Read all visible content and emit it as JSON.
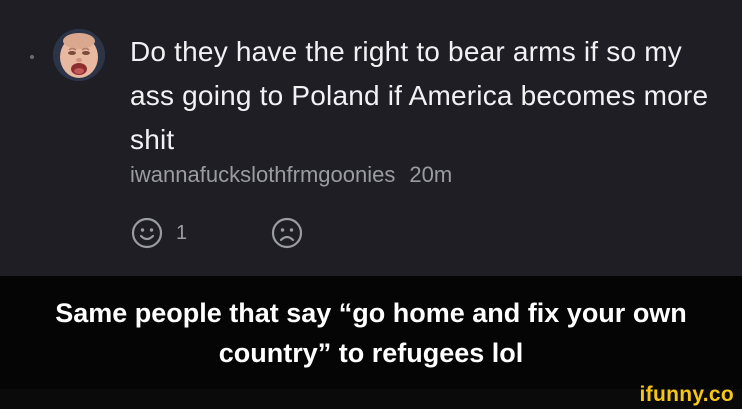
{
  "comment": {
    "text": "Do they have the right to bear arms if so my ass going to Poland if America becomes more shit",
    "username": "iwannafuckslothfrmgoonies",
    "time": "20m",
    "likes": "1",
    "icons": {
      "avatar": "baby-face-avatar",
      "like": "smiley-face-icon",
      "dislike": "frown-face-icon"
    }
  },
  "caption": {
    "text": "Same people that say “go home and fix your own country” to refugees lol"
  },
  "watermark": {
    "text": "ifunny.co"
  },
  "colors": {
    "card_background": "#1e1e24",
    "caption_background": "#050505",
    "comment_text": "#f2f2f4",
    "muted_text": "#9b9ba3",
    "watermark": "#f5c518"
  }
}
